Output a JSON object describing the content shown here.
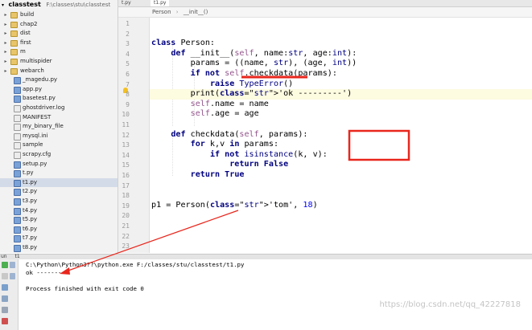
{
  "project": {
    "root_name": "classtest",
    "root_path": "F:\\classes\\stu\\classtest",
    "items": [
      {
        "label": "build",
        "type": "folder"
      },
      {
        "label": "chap2",
        "type": "folder"
      },
      {
        "label": "dist",
        "type": "folder"
      },
      {
        "label": "first",
        "type": "folder"
      },
      {
        "label": "m",
        "type": "folder"
      },
      {
        "label": "multispider",
        "type": "folder"
      },
      {
        "label": "webarch",
        "type": "folder"
      },
      {
        "label": "_magedu.py",
        "type": "py"
      },
      {
        "label": "app.py",
        "type": "py"
      },
      {
        "label": "basetest.py",
        "type": "py"
      },
      {
        "label": "ghostdriver.log",
        "type": "txt"
      },
      {
        "label": "MANIFEST",
        "type": "txt"
      },
      {
        "label": "my_binary_file",
        "type": "txt"
      },
      {
        "label": "mysql.ini",
        "type": "txt"
      },
      {
        "label": "sample",
        "type": "txt"
      },
      {
        "label": "scrapy.cfg",
        "type": "txt"
      },
      {
        "label": "setup.py",
        "type": "py"
      },
      {
        "label": "t.py",
        "type": "py"
      },
      {
        "label": "t1.py",
        "type": "py",
        "selected": true
      },
      {
        "label": "t2.py",
        "type": "py"
      },
      {
        "label": "t3.py",
        "type": "py"
      },
      {
        "label": "t4.py",
        "type": "py"
      },
      {
        "label": "t5.py",
        "type": "py"
      },
      {
        "label": "t6.py",
        "type": "py"
      },
      {
        "label": "t7.py",
        "type": "py"
      },
      {
        "label": "t8.py",
        "type": "py"
      }
    ]
  },
  "editor": {
    "tabs": [
      {
        "label": "t.py"
      },
      {
        "label": "t1.py"
      }
    ],
    "breadcrumb": [
      "Person",
      "__init__()"
    ],
    "line_numbers": [
      "1",
      "2",
      "3",
      "4",
      "5",
      "6",
      "7",
      "8",
      "9",
      "10",
      "11",
      "12",
      "13",
      "14",
      "15",
      "16",
      "17",
      "18",
      "19",
      "20",
      "21",
      "22",
      "23"
    ],
    "current_line": "8",
    "code_lines": [
      "",
      "",
      "class Person:",
      "    def __init__(self, name:str, age:int):",
      "        params = ((name, str), (age, int))",
      "        if not self.checkdata(params):",
      "            raise TypeError()",
      "        print('ok ---------')",
      "        self.name = name",
      "        self.age = age",
      "",
      "    def checkdata(self, params):",
      "        for k,v in params:",
      "            if not isinstance(k, v):",
      "                return False",
      "        return True",
      "",
      "",
      "p1 = Person('tom', 18)",
      "",
      "",
      "",
      ""
    ]
  },
  "run": {
    "header": "un",
    "tab_label": "t1",
    "command": "C:\\Python\\Python3??\\python.exe F:/classes/stu/classtest/t1.py",
    "output": "ok ---------",
    "exit_message": "Process finished with exit code 0"
  },
  "watermark": "https://blog.csdn.net/qq_42227818",
  "colors": {
    "annotation_red": "#e8261c",
    "keyword": "#000080",
    "string": "#008080",
    "number": "#0000ff",
    "self": "#94558d",
    "selection": "#d4dbe8"
  }
}
